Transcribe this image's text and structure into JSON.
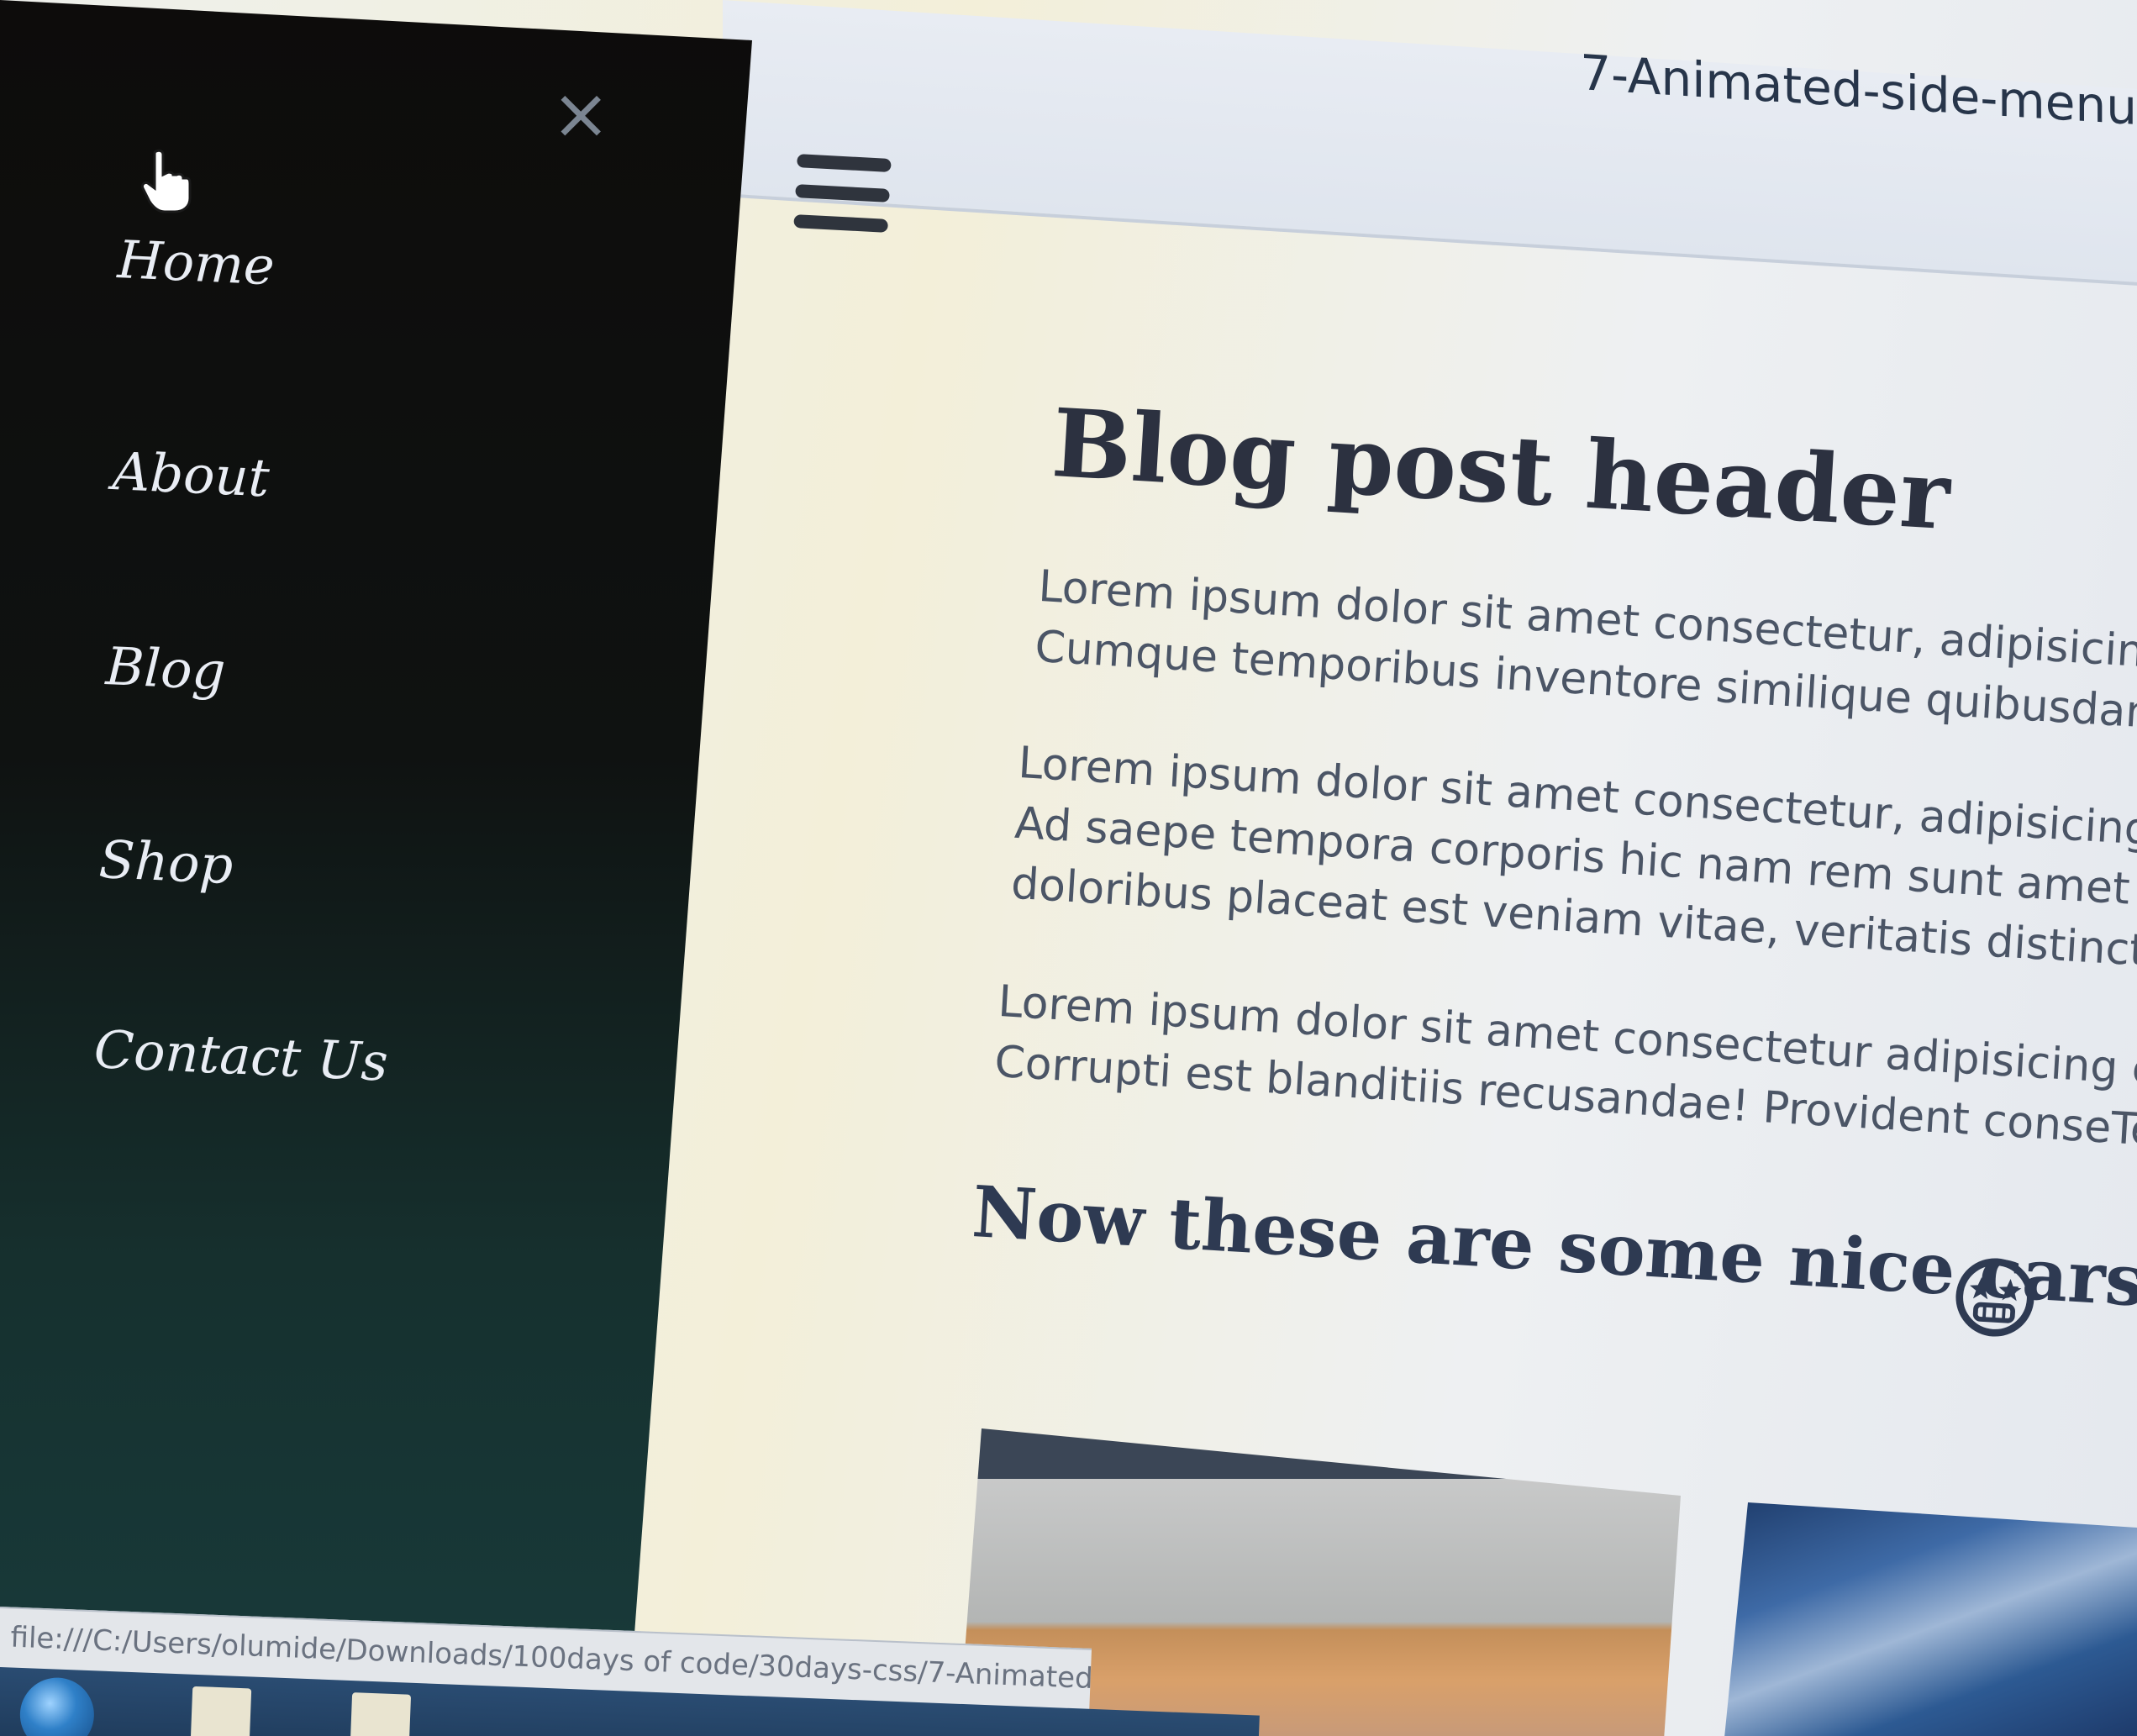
{
  "browser": {
    "tab_title": "7-Animated-side-menu",
    "status_url": "file:///C:/Users/olumide/Downloads/100days of code/30days-css/7-Animated"
  },
  "sidebar": {
    "close_label": "×",
    "items": [
      {
        "label": "Home"
      },
      {
        "label": "About"
      },
      {
        "label": "Blog"
      },
      {
        "label": "Shop"
      },
      {
        "label": "Contact Us"
      }
    ]
  },
  "main": {
    "post_title": "Blog post header",
    "paragraphs": [
      [
        "Lorem ipsum dolor sit amet consectetur, adipisicing eli",
        "Cumque temporibus inventore similique quibusdam lab"
      ],
      [
        "Lorem ipsum dolor sit amet consectetur, adipisicing elit.",
        "Ad saepe tempora corporis hic nam rem sunt amet soluta",
        "doloribus placeat est veniam vitae, veritatis distinctio, elig"
      ],
      [
        "Lorem ipsum dolor sit amet consectetur adipisicing elit. Su",
        "Corrupti est blanditiis recusandae! Provident conseTempora"
      ]
    ],
    "cars_heading": "Now these are some nice cars!",
    "emoji": "star-struck-emoji-icon"
  },
  "colors": {
    "sidebar_bg": "#0d0c0b",
    "nav_text": "#e9edf4",
    "heading_text": "#2c3140",
    "body_text": "#4b5566"
  }
}
